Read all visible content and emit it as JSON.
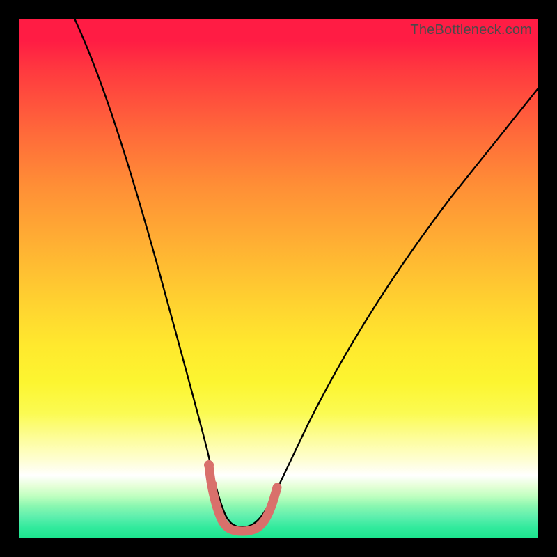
{
  "watermark": "TheBottleneck.com",
  "colors": {
    "frame": "#000000",
    "curve": "#000000",
    "valleyMarker": "#d9706b"
  },
  "chart_data": {
    "type": "line",
    "title": "",
    "xlabel": "",
    "ylabel": "",
    "xlim": [
      0,
      100
    ],
    "ylim": [
      0,
      100
    ],
    "series": [
      {
        "name": "bottleneck-curve",
        "x": [
          0,
          5,
          10,
          15,
          20,
          25,
          30,
          33,
          36,
          38,
          40,
          42,
          44,
          47,
          50,
          55,
          60,
          65,
          70,
          75,
          80,
          85,
          90,
          95,
          100
        ],
        "y": [
          102,
          92,
          80,
          68,
          55,
          42,
          28,
          18,
          10,
          6,
          3,
          2,
          2,
          3,
          6,
          12,
          20,
          28,
          35,
          42,
          49,
          55,
          61,
          67,
          72
        ]
      },
      {
        "name": "valley-marker",
        "x": [
          36,
          37,
          38,
          39,
          40,
          41,
          42,
          43,
          44,
          45,
          46,
          47
        ],
        "y": [
          10,
          5.5,
          3.5,
          2.5,
          2,
          2,
          2,
          2.2,
          2.6,
          3.2,
          4.2,
          5.5
        ]
      }
    ],
    "grid": false,
    "legend": false
  }
}
